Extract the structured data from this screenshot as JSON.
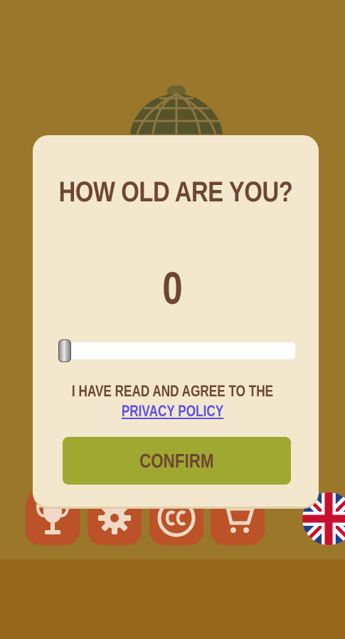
{
  "dialog": {
    "title": "HOW OLD ARE YOU?",
    "age_value": "0",
    "slider": {
      "min": 0,
      "value": 0
    },
    "agree_text": "I HAVE READ AND AGREE TO THE",
    "privacy_link": "PRIVACY POLICY",
    "confirm_label": "CONFIRM"
  },
  "menu": {
    "icons": [
      "trophy-icon",
      "gear-icon",
      "cc-icon",
      "cart-icon"
    ],
    "language_flag": "uk-flag-icon"
  },
  "colors": {
    "background": "#9a772b",
    "bottom_band": "#98681f",
    "modal": "#f3e8cd",
    "text_brown": "#6e4631",
    "confirm_button": "#9fa830",
    "link": "#5b4ff0",
    "icon_tile": "#bb5228"
  }
}
